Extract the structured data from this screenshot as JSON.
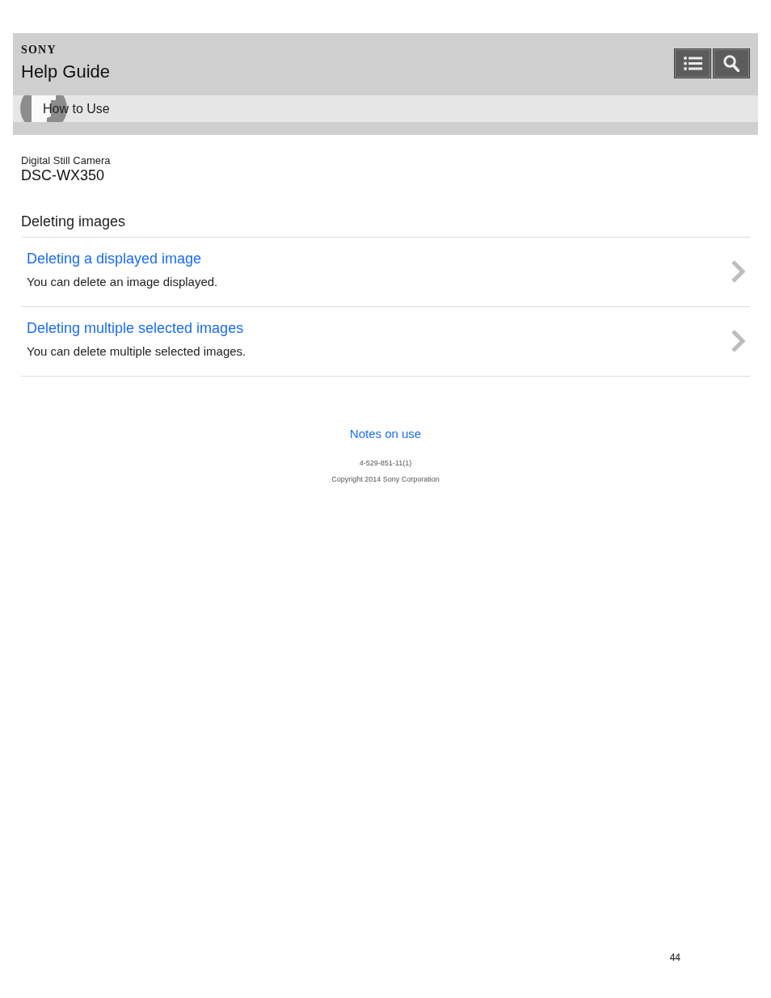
{
  "header": {
    "brand": "SONY",
    "title": "Help Guide"
  },
  "breadcrumb": {
    "label": "How to Use"
  },
  "product": {
    "category": "Digital Still Camera",
    "model": "DSC-WX350"
  },
  "section_title": "Deleting images",
  "topics": [
    {
      "title": "Deleting a displayed image",
      "description": "You can delete an image displayed."
    },
    {
      "title": "Deleting multiple selected images",
      "description": "You can delete multiple selected images."
    }
  ],
  "footer": {
    "link": "Notes on use",
    "doc_number": "4-529-851-11(1)",
    "copyright": "Copyright 2014 Sony Corporation"
  },
  "page_number": "44"
}
